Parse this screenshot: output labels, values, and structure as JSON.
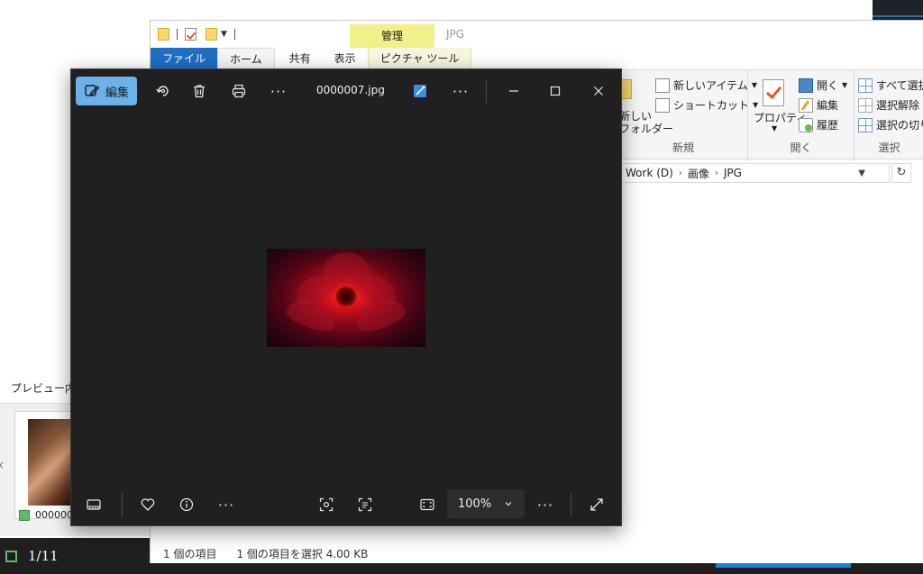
{
  "explorer": {
    "title": "JPG",
    "contextual_group": "管理",
    "tabs": [
      "ファイル",
      "ホーム",
      "共有",
      "表示",
      "ピクチャ ツール"
    ],
    "ribbon": {
      "new_item": "新しいアイテム",
      "shortcut": "ショートカット",
      "new_folder_line1": "新しい",
      "new_folder_line2": "フォルダー",
      "group_new": "新規",
      "properties": "プロパティ",
      "open": "開く",
      "edit": "編集",
      "history": "履歴",
      "group_open": "開く",
      "select_all": "すべて選択",
      "select_none": "選択解除",
      "invert_selection": "選択の切り",
      "group_select": "選択"
    },
    "address": {
      "crumbs": [
        "Work (D)",
        "画像",
        "JPG"
      ]
    },
    "status": {
      "items": "1 個の項目",
      "selected": "1 個の項目を選択  4.00 KB"
    }
  },
  "background": {
    "preview_label": "プレビュー内",
    "thumb_caption": "000000",
    "page_counter": "1/11"
  },
  "viewer": {
    "edit_label": "編集",
    "filename": "0000007.jpg",
    "zoom": "100%"
  }
}
